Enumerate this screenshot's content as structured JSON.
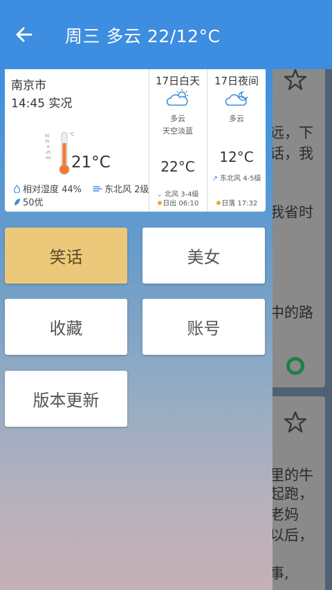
{
  "appbar": {
    "title": "周三 多云 22/12°C",
    "back_icon": "arrow-left-icon"
  },
  "weather": {
    "city": "南京市",
    "time": "14:45 实况",
    "current_temp": "21°C",
    "humidity": "相对湿度 44%",
    "wind": "东北风 2级",
    "aqi": "50优",
    "thermometer_scale": [
      "50",
      "25",
      "0",
      "-25",
      "-50"
    ],
    "thermometer_unit": "°C",
    "day": {
      "title": "17日白天",
      "condition": "多云",
      "sky": "天空淡蓝",
      "temp": "22°C",
      "wind": "北风 3-4级",
      "sun": "日出 06:10"
    },
    "night": {
      "title": "17日夜间",
      "condition": "多云",
      "temp": "12°C",
      "wind": "东北风 4-5级",
      "sun": "日落 17:32"
    }
  },
  "menu": {
    "jokes": "笑话",
    "beauty": "美女",
    "favorites": "收藏",
    "account": "账号",
    "update": "版本更新"
  },
  "feed": {
    "card1_lines": [
      "远，下",
      "话，我",
      "",
      "我省时",
      "",
      "中的路"
    ],
    "card2_lines": [
      "里的牛",
      "起跑，",
      "老妈",
      "以后，",
      "事,"
    ]
  },
  "colors": {
    "appbar": "#3d8de0",
    "active_button": "#ecc97a",
    "feed_icon": "#1e7f4a"
  }
}
